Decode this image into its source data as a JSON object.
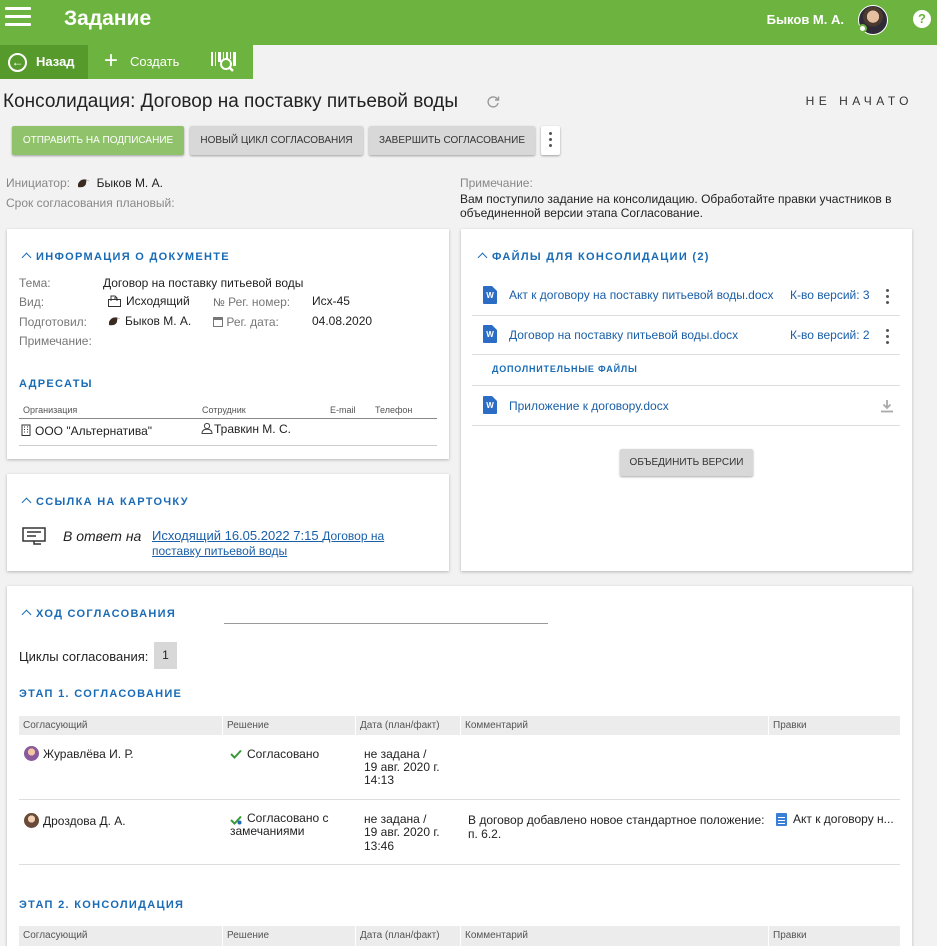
{
  "header": {
    "title": "Задание",
    "user": "Быков М. А.",
    "help": "?"
  },
  "toolbar": {
    "back": "Назад",
    "create": "Создать"
  },
  "doc": {
    "title": "Консолидация: Договор на поставку питьевой воды",
    "status": "НЕ НАЧАТО"
  },
  "actions": {
    "send": "ОТПРАВИТЬ НА ПОДПИСАНИЕ",
    "new_cycle": "НОВЫЙ ЦИКЛ СОГЛАСОВАНИЯ",
    "finish": "ЗАВЕРШИТЬ СОГЛАСОВАНИЕ"
  },
  "meta": {
    "initiator_label": "Инициатор:",
    "initiator": "Быков М. А.",
    "deadline_label": "Срок согласования плановый:",
    "note_label": "Примечание:",
    "note_line1": "Вам поступило задание на консолидацию. Обработайте правки участников в",
    "note_line2": "объединенной версии этапа Согласование."
  },
  "doc_info": {
    "title": "ИНФОРМАЦИЯ О ДОКУМЕНТЕ",
    "topic_label": "Тема:",
    "topic": "Договор на поставку питьевой воды",
    "kind_label": "Вид:",
    "kind": "Исходящий",
    "regnum_label": "Рег. номер:",
    "regnum": "Исх-45",
    "prepared_label": "Подготовил:",
    "prepared": "Быков М. А.",
    "regdate_label": "Рег. дата:",
    "regdate": "04.08.2020",
    "note_label": "Примечание:"
  },
  "addressees": {
    "title": "АДРЕСАТЫ",
    "headers": [
      "Организация",
      "Сотрудник",
      "E-mail",
      "Телефон"
    ],
    "rows": [
      {
        "org": "ООО \"Альтернатива\"",
        "employee": "Травкин М. С."
      }
    ]
  },
  "card_link": {
    "title": "ССЫЛКА НА КАРТОЧКУ",
    "reply_label": "В ответ на",
    "link_a": "Исходящий 16.05.2022 7:15",
    "link_b": "Договор на",
    "link_c": "поставку питьевой воды"
  },
  "files": {
    "title": "ФАЙЛЫ ДЛЯ КОНСОЛИДАЦИИ (2)",
    "items": [
      {
        "name": "Акт к договору на поставку питьевой воды.docx",
        "versions": "К-во версий: 3"
      },
      {
        "name": "Договор на поставку питьевой воды.docx",
        "versions": "К-во версий: 2"
      }
    ],
    "extra_title": "ДОПОЛНИТЕЛЬНЫЕ ФАЙЛЫ",
    "extra": [
      {
        "name": "Приложение к договору.docx"
      }
    ],
    "merge": "ОБЪЕДИНИТЬ ВЕРСИИ",
    "word": "W"
  },
  "approval": {
    "title": "ХОД СОГЛАСОВАНИЯ",
    "cycles_label": "Циклы согласования:",
    "cycle": "1",
    "headers": [
      "Согласующий",
      "Решение",
      "Дата (план/факт)",
      "Комментарий",
      "Правки"
    ],
    "stage1": {
      "title": "ЭТАП 1. СОГЛАСОВАНИЕ",
      "rows": [
        {
          "name": "Журавлёва И. Р.",
          "decision": "Согласовано",
          "decision2": "",
          "date1": "не задана /",
          "date2": "19 авг. 2020 г.",
          "date3": "14:13",
          "comment1": "",
          "comment2": "",
          "edits": ""
        },
        {
          "name": "Дроздова Д. А.",
          "decision": "Согласовано с",
          "decision2": "замечаниями",
          "date1": "не задана /",
          "date2": "19 авг. 2020 г.",
          "date3": "13:46",
          "comment1": "В договор добавлено новое стандартное положение:",
          "comment2": "п. 6.2.",
          "edits": "Акт к договору н..."
        }
      ]
    },
    "stage2": {
      "title": "ЭТАП 2. КОНСОЛИДАЦИЯ"
    }
  },
  "colors": {
    "green": "#6db33f",
    "blue": "#1a6bb5",
    "link": "#1a5fa8"
  }
}
